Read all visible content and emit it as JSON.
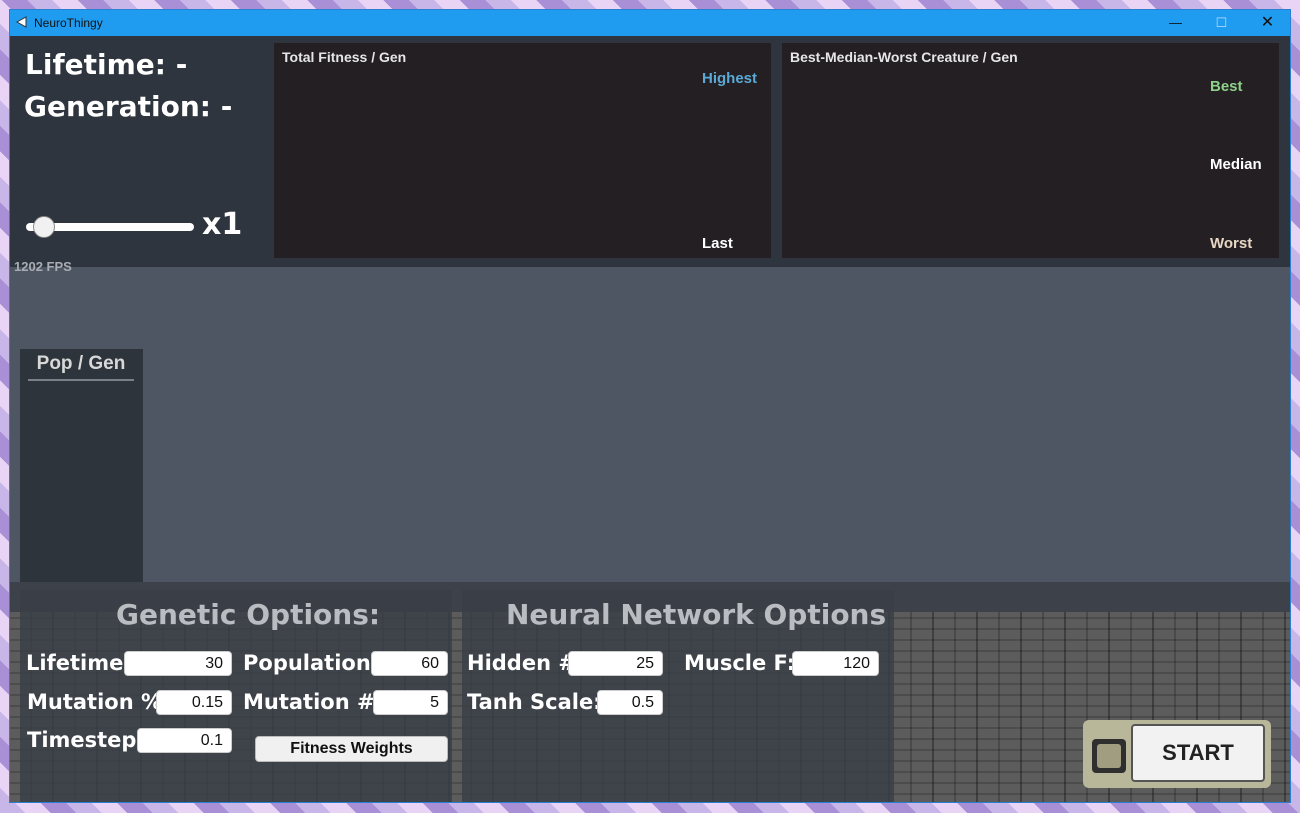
{
  "window": {
    "title": "NeuroThingy",
    "minimize": "—",
    "maximize": "☐",
    "close": "✕"
  },
  "stats": {
    "lifetime": "Lifetime: -",
    "generation": "Generation: -",
    "speed": "x1",
    "fps": "1202 FPS"
  },
  "speed_slider": {
    "value_fraction": 0.05
  },
  "graphs": {
    "fitness": {
      "title": "Total Fitness / Gen",
      "label_top": "Highest",
      "label_bottom": "Last",
      "label_top_color": "#5aa9d6",
      "label_bottom_color": "#ffffff"
    },
    "creature": {
      "title": "Best-Median-Worst Creature / Gen",
      "best": "Best",
      "median": "Median",
      "worst": "Worst",
      "best_color": "#8fd08a",
      "median_color": "#ffffff",
      "worst_color": "#e8d7c4"
    }
  },
  "pop_panel": {
    "title": "Pop / Gen"
  },
  "genetic": {
    "title": "Genetic Options:",
    "lifetime_label": "Lifetime:",
    "lifetime_value": "30",
    "population_label": "Population:",
    "population_value": "60",
    "mutation_pct_label": "Mutation %:",
    "mutation_pct_value": "0.15",
    "mutation_num_label": "Mutation #:",
    "mutation_num_value": "5",
    "timestep_label": "Timestep:",
    "timestep_value": "0.1",
    "fitness_weights_button": "Fitness Weights"
  },
  "neural": {
    "title": "Neural Network Options",
    "hidden_label": "Hidden #",
    "hidden_value": "25",
    "muscle_label": "Muscle F:",
    "muscle_value": "120",
    "tanh_label": "Tanh Scale:",
    "tanh_value": "0.5"
  },
  "start": {
    "label": "START"
  }
}
